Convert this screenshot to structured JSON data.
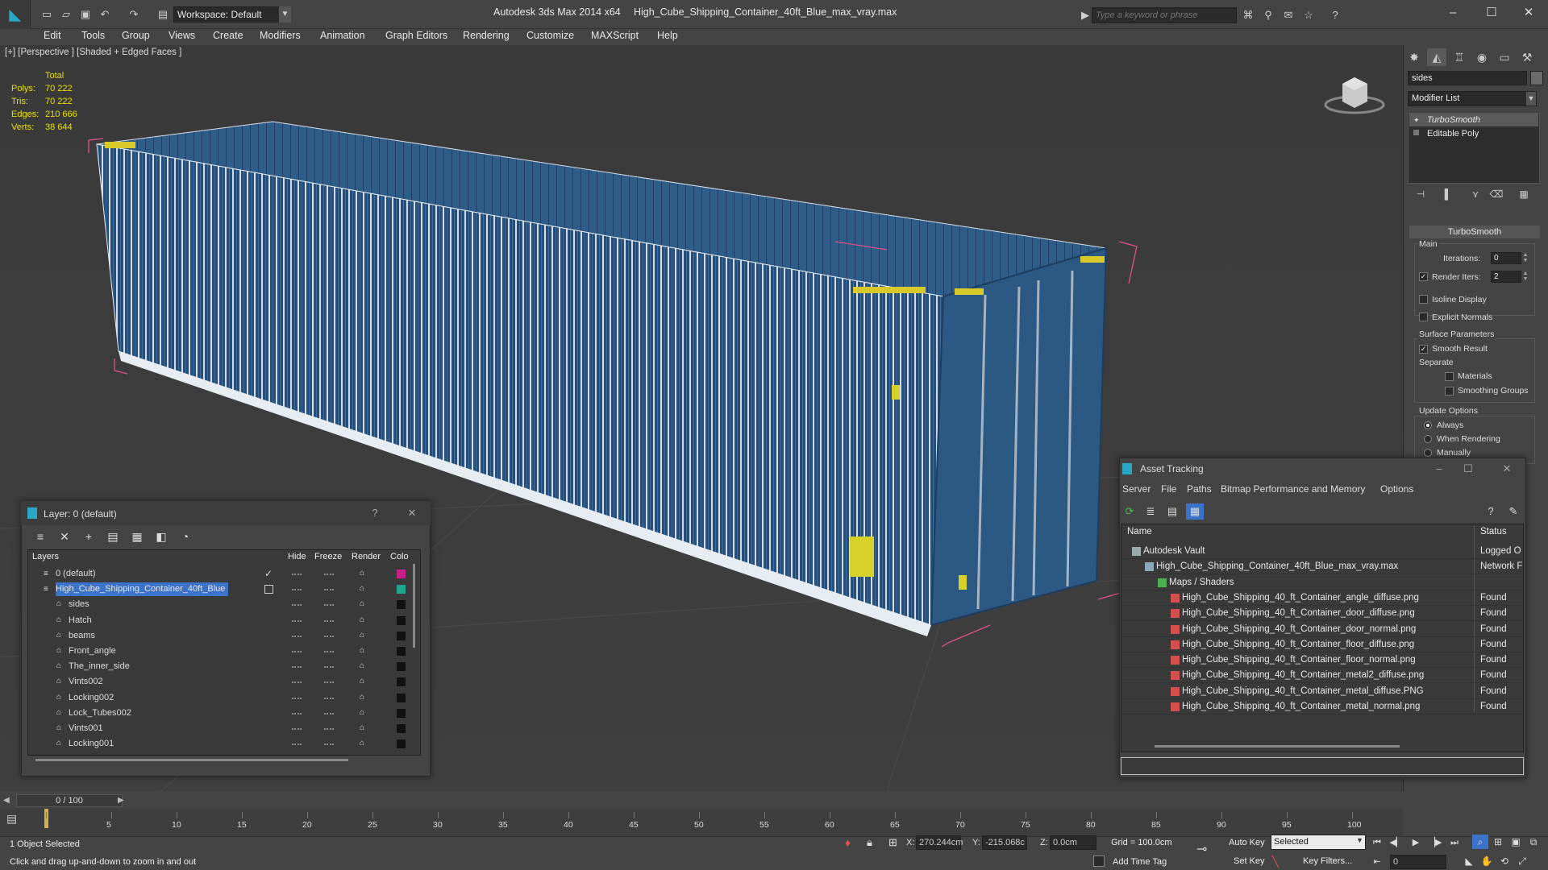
{
  "app": {
    "title": "Autodesk 3ds Max  2014 x64",
    "file": "High_Cube_Shipping_Container_40ft_Blue_max_vray.max",
    "workspace": "Workspace: Default",
    "search_placeholder": "Type a keyword or phrase"
  },
  "menu": [
    "Edit",
    "Tools",
    "Group",
    "Views",
    "Create",
    "Modifiers",
    "Animation",
    "Graph Editors",
    "Rendering",
    "Customize",
    "MAXScript",
    "Help"
  ],
  "viewport": {
    "label": "[+] [Perspective ] [Shaded + Edged Faces ]",
    "stats": {
      "header": "Total",
      "rows": [
        {
          "k": "Polys:",
          "v": "70 222"
        },
        {
          "k": "Tris:",
          "v": "70 222"
        },
        {
          "k": "Edges:",
          "v": "210 666"
        },
        {
          "k": "Verts:",
          "v": "38 644"
        }
      ]
    }
  },
  "command_panel": {
    "object_name": "sides",
    "modifier_list": "Modifier List",
    "stack": [
      "TurboSmooth",
      "Editable Poly"
    ],
    "rollout_title": "TurboSmooth",
    "main_group": "Main",
    "iterations_label": "Iterations:",
    "iterations_value": "0",
    "render_iters_label": "Render Iters:",
    "render_iters_value": "2",
    "isoline_label": "Isoline Display",
    "explicit_label": "Explicit Normals",
    "surface_group": "Surface Parameters",
    "smooth_result_label": "Smooth Result",
    "separate_label": "Separate",
    "materials_label": "Materials",
    "smoothing_groups_label": "Smoothing Groups",
    "update_group": "Update Options",
    "always_label": "Always",
    "when_rendering_label": "When Rendering",
    "manually_label": "Manually"
  },
  "layer_dialog": {
    "title": "Layer: 0 (default)",
    "help": "?",
    "columns": {
      "layers": "Layers",
      "hide": "Hide",
      "freeze": "Freeze",
      "render": "Render",
      "color": "Colo"
    },
    "rows": [
      {
        "name": "0 (default)",
        "indent": 0,
        "type": "layer",
        "color": "#c4228a",
        "checked": true
      },
      {
        "name": "High_Cube_Shipping_Container_40ft_Blue",
        "indent": 0,
        "type": "layer",
        "color": "#20a58e",
        "selected": true
      },
      {
        "name": "sides",
        "indent": 1,
        "type": "object",
        "color": "#111111"
      },
      {
        "name": "Hatch",
        "indent": 1,
        "type": "object",
        "color": "#111111"
      },
      {
        "name": "beams",
        "indent": 1,
        "type": "object",
        "color": "#111111"
      },
      {
        "name": "Front_angle",
        "indent": 1,
        "type": "object",
        "color": "#111111"
      },
      {
        "name": "The_inner_side",
        "indent": 1,
        "type": "object",
        "color": "#111111"
      },
      {
        "name": "Vints002",
        "indent": 1,
        "type": "object",
        "color": "#111111"
      },
      {
        "name": "Locking002",
        "indent": 1,
        "type": "object",
        "color": "#111111"
      },
      {
        "name": "Lock_Tubes002",
        "indent": 1,
        "type": "object",
        "color": "#111111"
      },
      {
        "name": "Vints001",
        "indent": 1,
        "type": "object",
        "color": "#111111"
      },
      {
        "name": "Locking001",
        "indent": 1,
        "type": "object",
        "color": "#111111"
      }
    ]
  },
  "asset_dialog": {
    "title": "Asset Tracking",
    "menu": [
      "Server",
      "File",
      "Paths",
      "Bitmap Performance and Memory",
      "Options"
    ],
    "columns": {
      "name": "Name",
      "status": "Status"
    },
    "rows": [
      {
        "name": "Autodesk Vault",
        "indent": 0,
        "status": "Logged O",
        "icon": "vault"
      },
      {
        "name": "High_Cube_Shipping_Container_40ft_Blue_max_vray.max",
        "indent": 1,
        "status": "Network F",
        "icon": "max"
      },
      {
        "name": "Maps / Shaders",
        "indent": 2,
        "status": "",
        "icon": "maps"
      },
      {
        "name": "High_Cube_Shipping_40_ft_Container_angle_diffuse.png",
        "indent": 3,
        "status": "Found",
        "icon": "png"
      },
      {
        "name": "High_Cube_Shipping_40_ft_Container_door_diffuse.png",
        "indent": 3,
        "status": "Found",
        "icon": "png"
      },
      {
        "name": "High_Cube_Shipping_40_ft_Container_door_normal.png",
        "indent": 3,
        "status": "Found",
        "icon": "png"
      },
      {
        "name": "High_Cube_Shipping_40_ft_Container_floor_diffuse.png",
        "indent": 3,
        "status": "Found",
        "icon": "png"
      },
      {
        "name": "High_Cube_Shipping_40_ft_Container_floor_normal.png",
        "indent": 3,
        "status": "Found",
        "icon": "png"
      },
      {
        "name": "High_Cube_Shipping_40_ft_Container_metal2_diffuse.png",
        "indent": 3,
        "status": "Found",
        "icon": "png"
      },
      {
        "name": "High_Cube_Shipping_40_ft_Container_metal_diffuse.PNG",
        "indent": 3,
        "status": "Found",
        "icon": "png"
      },
      {
        "name": "High_Cube_Shipping_40_ft_Container_metal_normal.png",
        "indent": 3,
        "status": "Found",
        "icon": "png"
      }
    ]
  },
  "timeline": {
    "slider_label": "0 / 100",
    "ticks": [
      "0",
      "5",
      "10",
      "15",
      "20",
      "25",
      "30",
      "35",
      "40",
      "45",
      "50",
      "55",
      "60",
      "65",
      "70",
      "75",
      "80",
      "85",
      "90",
      "95",
      "100"
    ]
  },
  "status": {
    "selection": "1 Object Selected",
    "prompt": "Click and drag up-and-down to zoom in and out",
    "x_label": "X:",
    "x_value": "270.244cm",
    "y_label": "Y:",
    "y_value": "-215.068c",
    "z_label": "Z:",
    "z_value": "0.0cm",
    "grid": "Grid = 100.0cm",
    "add_time_tag": "Add Time Tag",
    "auto_key": "Auto Key",
    "set_key": "Set Key",
    "selected": "Selected",
    "key_filters": "Key Filters...",
    "frame": "0"
  },
  "colors": {
    "accent": "#2aa7c7",
    "selection": "#3a73c9",
    "container_blue": "#2d5a86",
    "stat_yellow": "#e8e000",
    "bbox_pink": "#e0508c"
  }
}
